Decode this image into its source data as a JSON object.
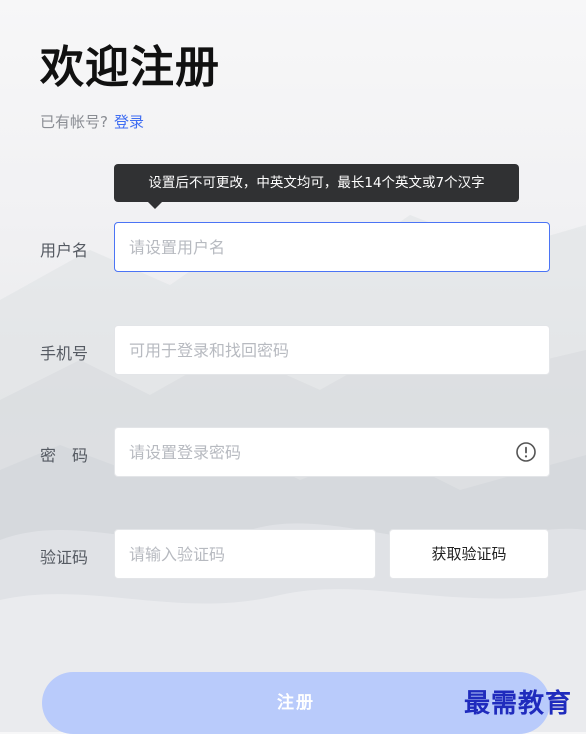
{
  "header": {
    "title": "欢迎注册",
    "have_account_text": "已有帐号?",
    "login_link": "登录"
  },
  "tooltip": {
    "text": "设置后不可更改，中英文均可，最长14个英文或7个汉字"
  },
  "form": {
    "username": {
      "label": "用户名",
      "placeholder": "请设置用户名"
    },
    "phone": {
      "label": "手机号",
      "placeholder": "可用于登录和找回密码"
    },
    "password": {
      "label": "密　码",
      "placeholder": "请设置登录密码"
    },
    "code": {
      "label": "验证码",
      "placeholder": "请输入验证码",
      "button": "获取验证码"
    }
  },
  "submit_label": "注册",
  "watermark": "最需教育",
  "colors": {
    "accent": "#3f6df2",
    "submit_disabled": "#b9cbfb",
    "tooltip_bg": "#303133"
  }
}
